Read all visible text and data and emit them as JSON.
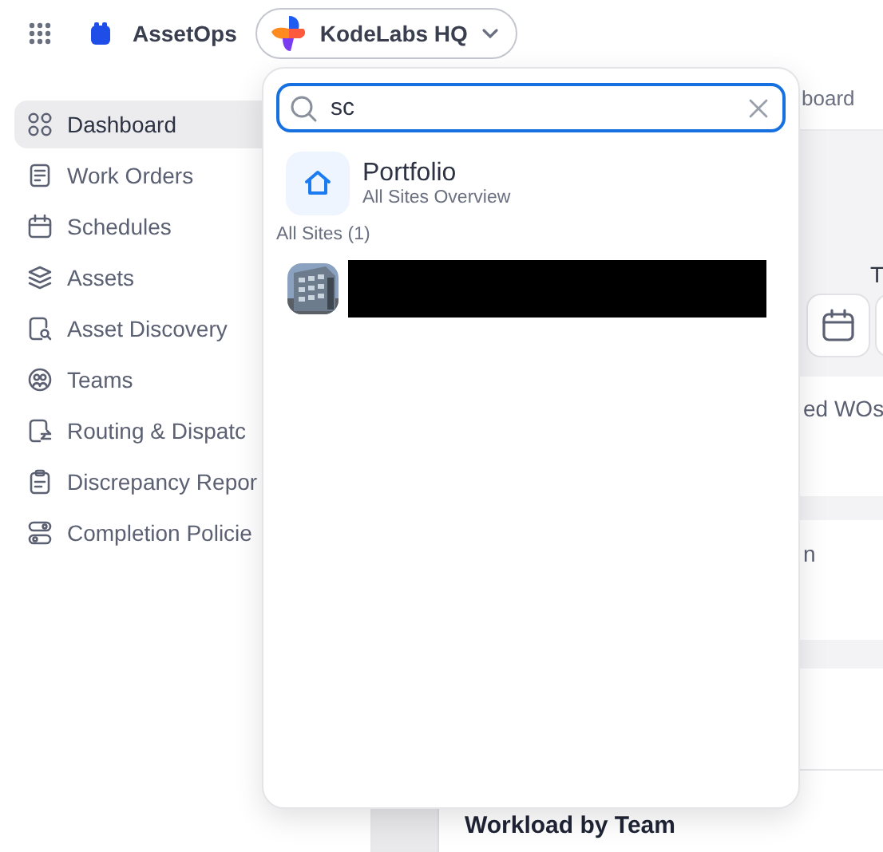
{
  "top_bar": {
    "app_name": "AssetOps",
    "site_selector": {
      "label": "KodeLabs HQ",
      "expanded": true
    }
  },
  "sidebar": {
    "items": [
      {
        "label": "Dashboard",
        "kind": "dashboard",
        "selected": true
      },
      {
        "label": "Work Orders",
        "kind": "orders",
        "selected": false
      },
      {
        "label": "Schedules",
        "kind": "calendar",
        "selected": false
      },
      {
        "label": "Assets",
        "kind": "layers",
        "selected": false
      },
      {
        "label": "Asset Discovery",
        "kind": "discovery",
        "selected": false
      },
      {
        "label": "Teams",
        "kind": "team",
        "selected": false
      },
      {
        "label": "Routing & Dispatc",
        "kind": "routing",
        "selected": false
      },
      {
        "label": "Discrepancy Repor",
        "kind": "clipboard",
        "selected": false
      },
      {
        "label": "Completion Policie",
        "kind": "toggles",
        "selected": false
      }
    ]
  },
  "background": {
    "breadcrumb": "board",
    "section_heading": "T",
    "stat_label": "ed WOs",
    "text_fragment": "n",
    "panel_title": "Workload by Team"
  },
  "site_switcher": {
    "search": {
      "value": "sc"
    },
    "portfolio": {
      "title": "Portfolio",
      "subtitle": "All Sites Overview"
    },
    "group_label": "All Sites (1)",
    "sites": [
      {
        "kind": "picture",
        "redacted": true
      }
    ]
  }
}
